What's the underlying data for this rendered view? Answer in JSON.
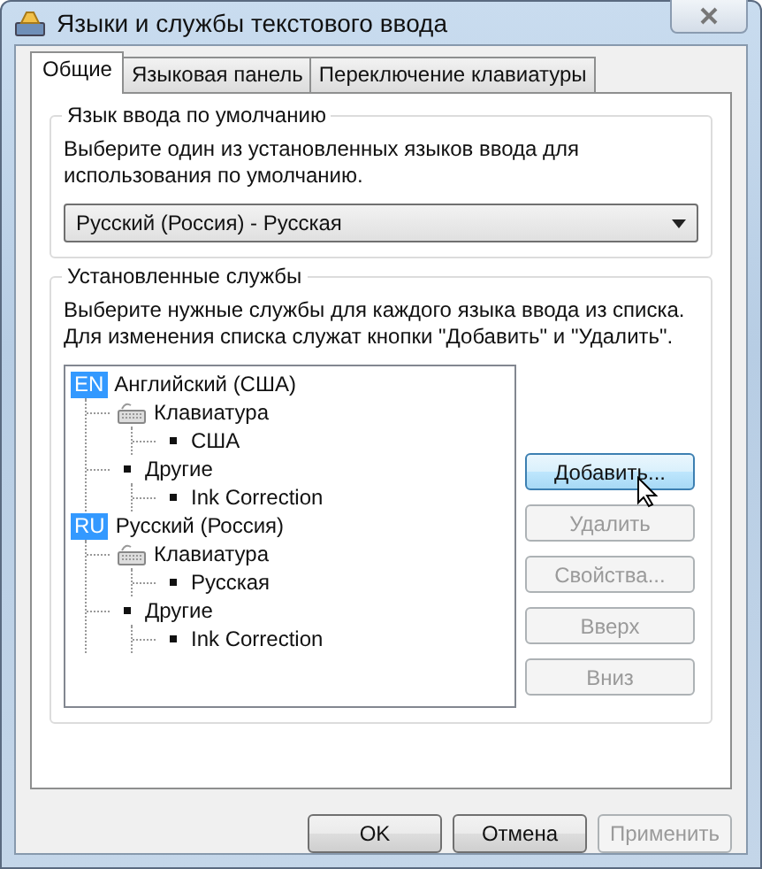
{
  "window": {
    "title": "Языки и службы текстового ввода"
  },
  "tabs": [
    {
      "label": "Общие",
      "selected": true
    },
    {
      "label": "Языковая панель",
      "selected": false
    },
    {
      "label": "Переключение клавиатуры",
      "selected": false
    }
  ],
  "default_language": {
    "legend": "Язык ввода по умолчанию",
    "description": "Выберите один из установленных языков ввода для использования по умолчанию.",
    "dropdown": {
      "value": "Русский (Россия) - Русская"
    }
  },
  "installed_services": {
    "legend": "Установленные службы",
    "description": "Выберите нужные службы для каждого языка ввода из списка. Для изменения списка служат кнопки \"Добавить\" и \"Удалить\".",
    "tree": [
      {
        "kind": "language",
        "badge": "EN",
        "label": "Английский (США)",
        "children": [
          {
            "kind": "keyboard",
            "label": "Клавиатура",
            "children": [
              {
                "kind": "item",
                "label": "США"
              }
            ]
          },
          {
            "kind": "item",
            "label": "Другие",
            "children": [
              {
                "kind": "item",
                "label": "Ink Correction"
              }
            ]
          }
        ]
      },
      {
        "kind": "language",
        "badge": "RU",
        "label": "Русский (Россия)",
        "children": [
          {
            "kind": "keyboard",
            "label": "Клавиатура",
            "children": [
              {
                "kind": "item",
                "label": "Русская"
              }
            ]
          },
          {
            "kind": "item",
            "label": "Другие",
            "children": [
              {
                "kind": "item",
                "label": "Ink Correction"
              }
            ]
          }
        ]
      }
    ],
    "buttons": [
      {
        "label": "Добавить...",
        "disabled": false,
        "hovered": true
      },
      {
        "label": "Удалить",
        "disabled": true,
        "hovered": false
      },
      {
        "label": "Свойства...",
        "disabled": true,
        "hovered": false
      },
      {
        "label": "Вверх",
        "disabled": true,
        "hovered": false
      },
      {
        "label": "Вниз",
        "disabled": true,
        "hovered": false
      }
    ]
  },
  "dialog_buttons": [
    {
      "label": "OK",
      "disabled": false
    },
    {
      "label": "Отмена",
      "disabled": false
    },
    {
      "label": "Применить",
      "disabled": true
    }
  ]
}
